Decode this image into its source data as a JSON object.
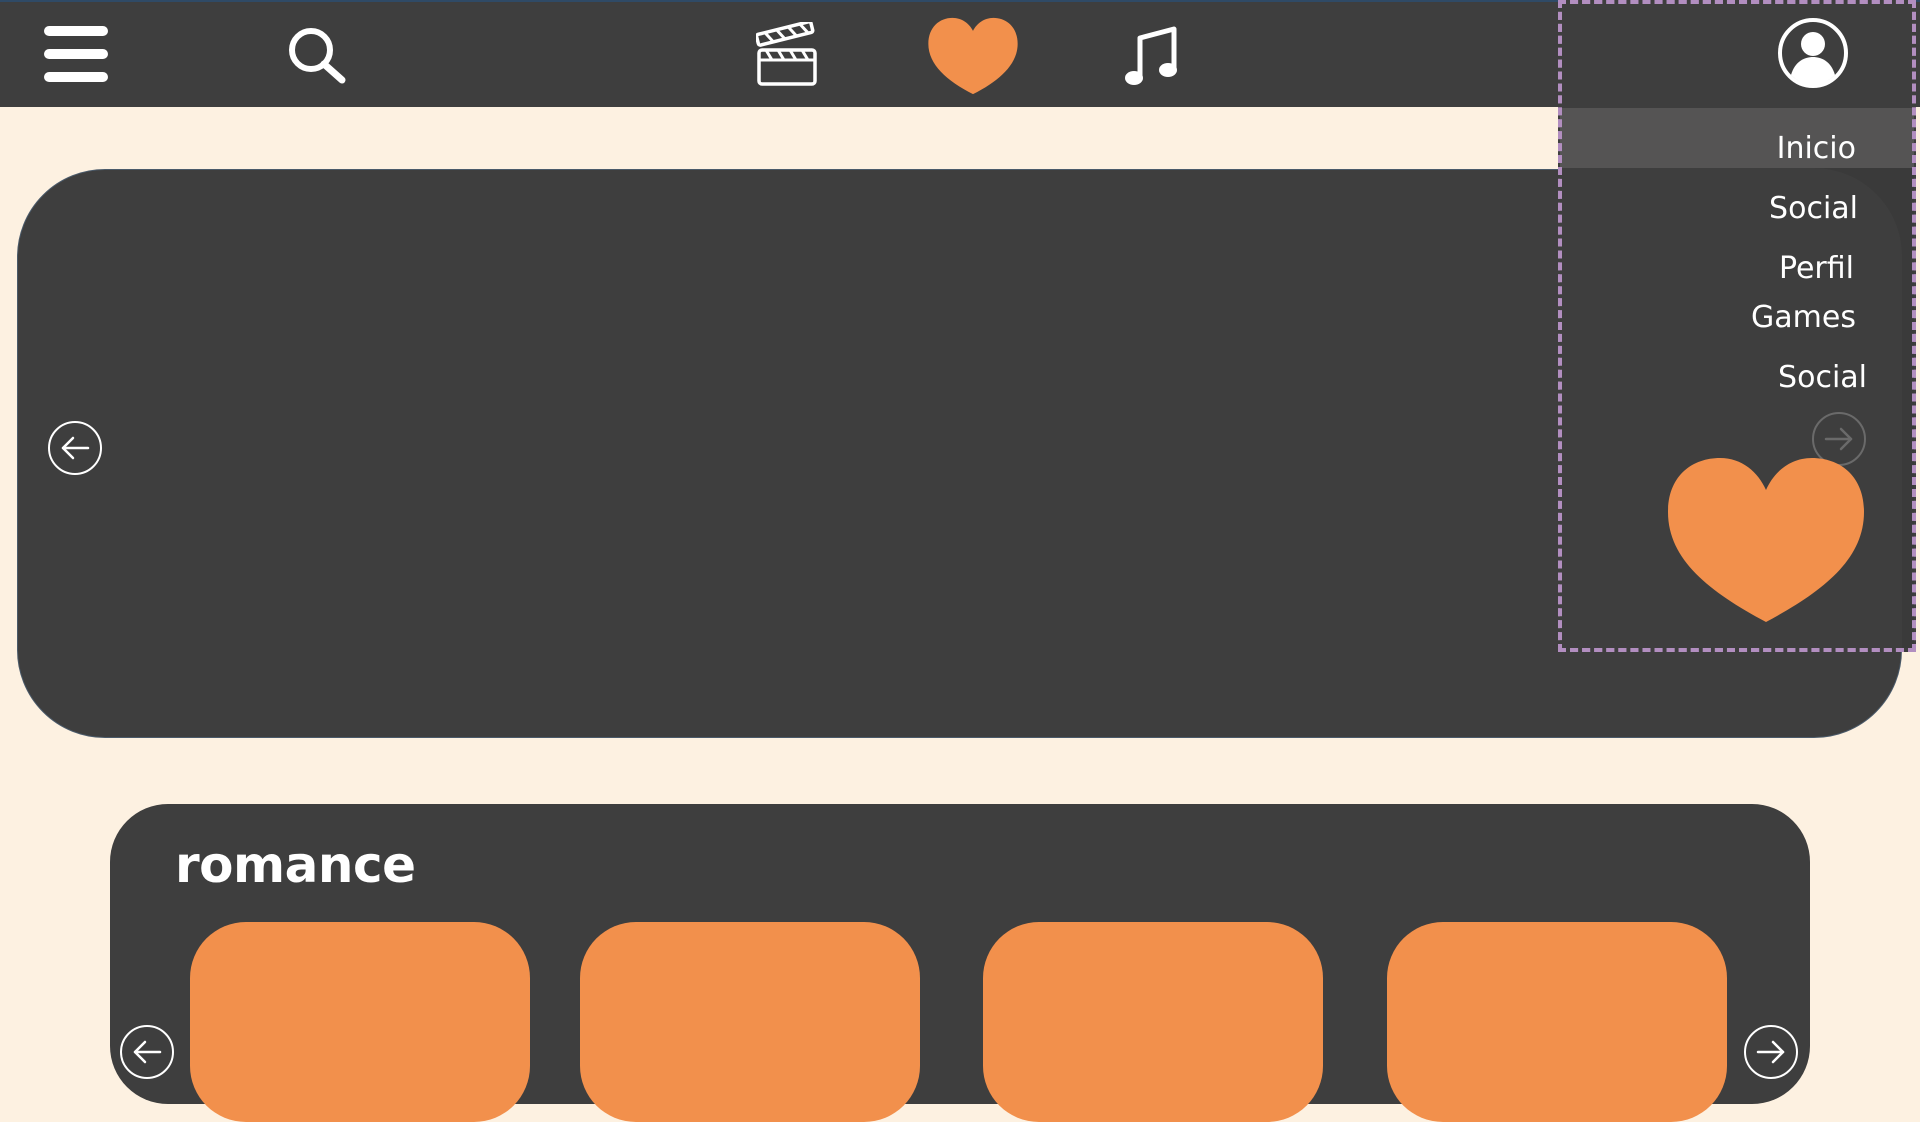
{
  "nav": {
    "menu_icon": "hamburger-icon",
    "search_icon": "search-icon",
    "movies_icon": "clapperboard-icon",
    "favorites_icon": "heart-icon",
    "music_icon": "music-note-icon",
    "profile_icon": "user-icon"
  },
  "colors": {
    "topbar": "#3e3e3e",
    "background": "#fdf1e1",
    "accent": "#f2904c",
    "panel": "#3e3e3e",
    "menu_border": "#b28ec0"
  },
  "hero": {
    "prev_icon": "arrow-left-circle-icon",
    "next_icon": "arrow-right-circle-icon"
  },
  "dropdown": {
    "items": [
      "Inicio",
      "Social",
      "Perfil",
      "Games",
      "Social"
    ],
    "decor_icon": "heart-icon"
  },
  "row": {
    "title": "romance",
    "cards": 4,
    "prev_icon": "arrow-left-circle-icon",
    "next_icon": "arrow-right-circle-icon"
  }
}
